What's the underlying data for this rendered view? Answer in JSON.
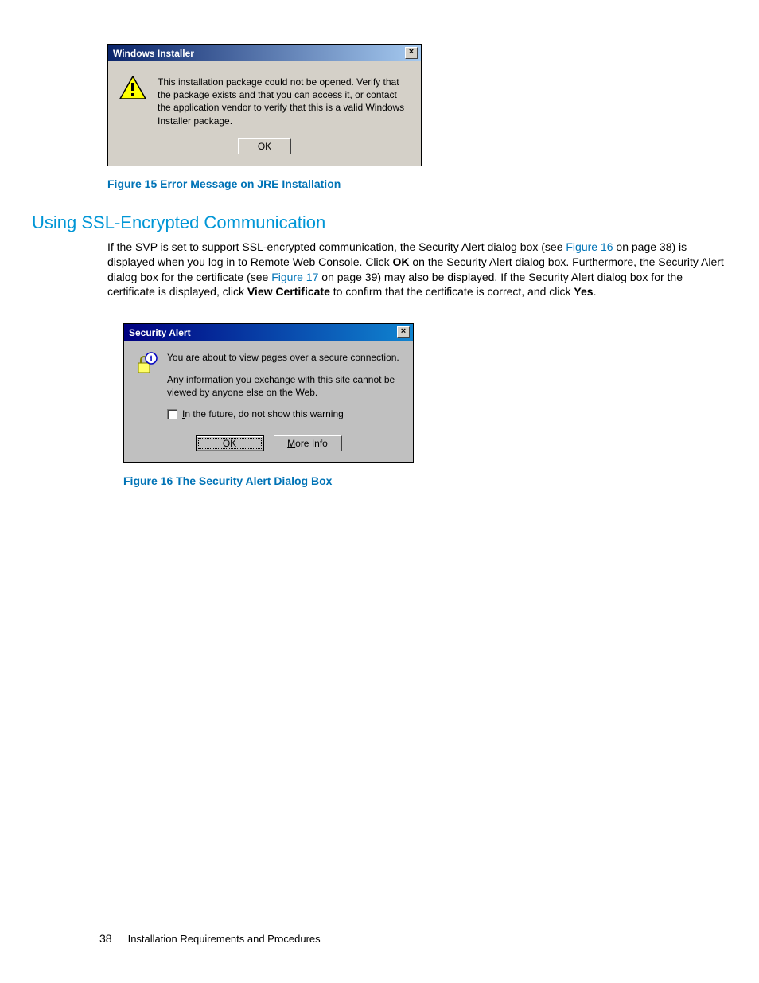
{
  "dialog1": {
    "title": "Windows Installer",
    "message": "This installation package could not be opened. Verify that the package exists and that you can access it, or contact the application vendor to verify that this is a valid Windows Installer package.",
    "ok": "OK"
  },
  "caption1": "Figure 15 Error Message on JRE Installation",
  "heading": "Using SSL-Encrypted Communication",
  "para": {
    "t1": "If the SVP is set to support SSL-encrypted communication, the Security Alert dialog box (see ",
    "link1": "Figure 16",
    "t2": " on page 38) is displayed when you log in to Remote Web Console. Click ",
    "b1": "OK",
    "t3": " on the Security Alert dialog box. Furthermore, the Security Alert dialog box for the certificate (see ",
    "link2": "Figure 17",
    "t4": " on page 39) may also be displayed. If the Security Alert dialog box for the certificate is displayed, click ",
    "b2": "View Certificate",
    "t5": " to confirm that the certificate is correct, and click ",
    "b3": "Yes",
    "t6": "."
  },
  "dialog2": {
    "title": "Security Alert",
    "line1": "You are about to view pages over a secure connection.",
    "line2": "Any information you exchange with this site cannot be viewed by anyone else on the Web.",
    "checkbox_pre": "I",
    "checkbox_rest": "n the future, do not show this warning",
    "ok": "OK",
    "more_pre": "M",
    "more_rest": "ore Info"
  },
  "caption2": "Figure 16 The Security Alert Dialog Box",
  "footer": {
    "page": "38",
    "section": "Installation Requirements and Procedures"
  }
}
